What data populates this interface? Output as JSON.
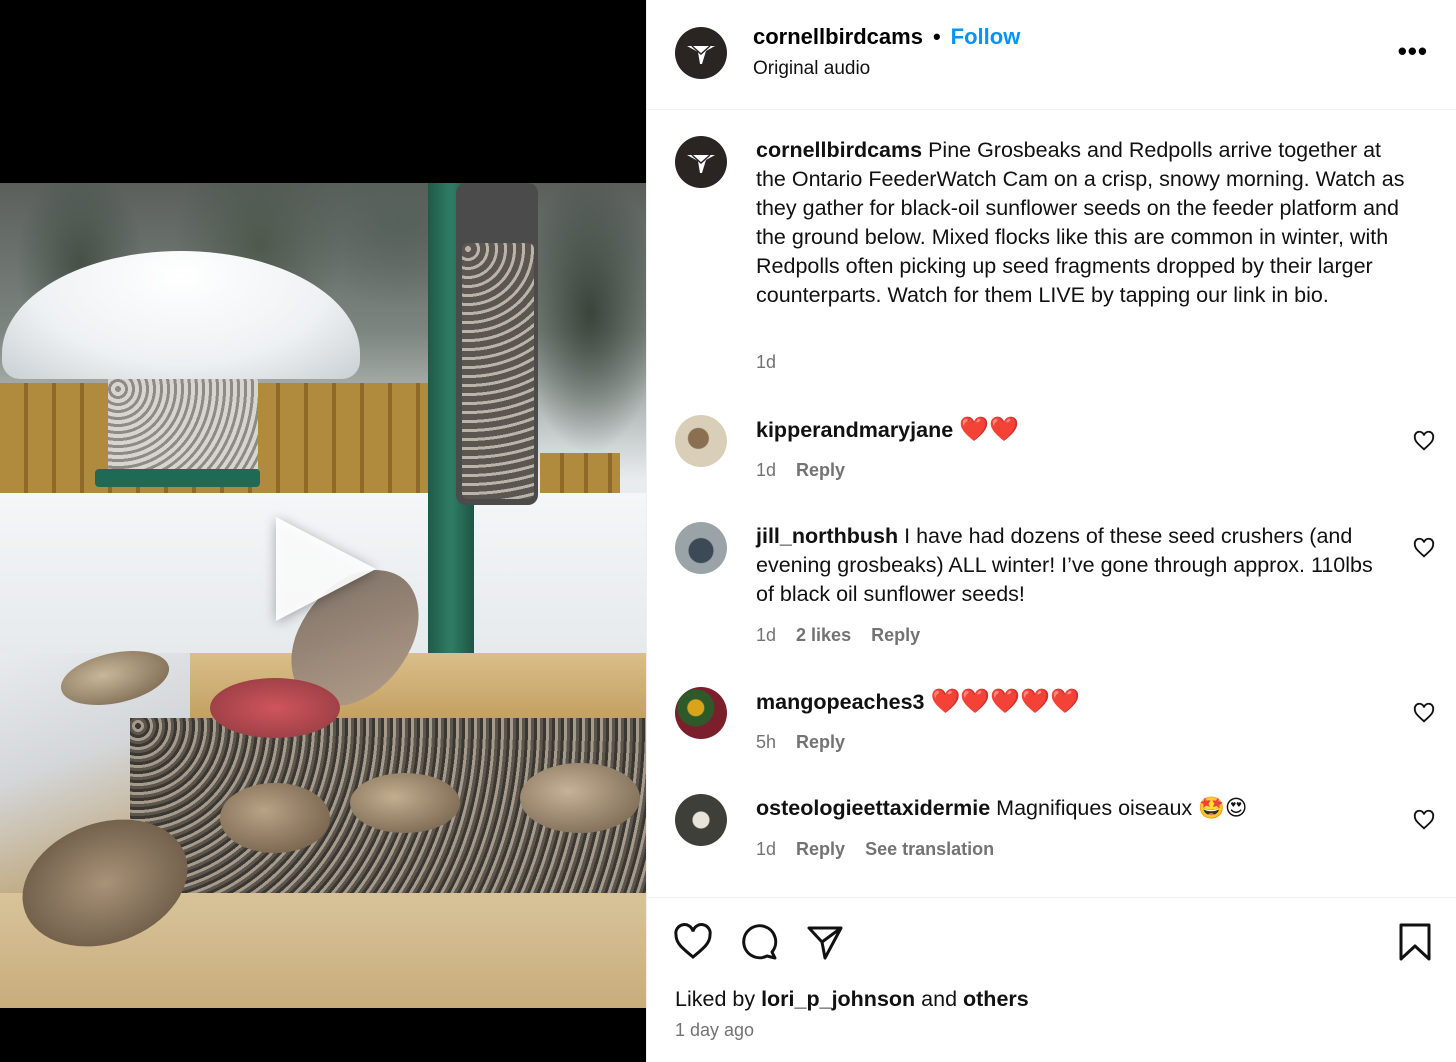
{
  "post": {
    "username": "cornellbirdcams",
    "follow_label": "Follow",
    "separator": "•",
    "audio": "Original audio",
    "more_label": "•••"
  },
  "caption": {
    "username": "cornellbirdcams",
    "text": "Pine Grosbeaks and Redpolls arrive together at the Ontario FeederWatch Cam on a crisp, snowy morning. Watch as they gather for black-oil sunflower seeds on the feeder platform and the ground below. Mixed flocks like this are common in winter, with Redpolls often picking up seed fragments dropped by their larger counterparts. Watch for them LIVE by tapping our link in bio.",
    "time": "1d"
  },
  "comments": [
    {
      "username": "kipperandmaryjane",
      "text": "",
      "emoji": "❤️❤️",
      "time": "1d",
      "likes": "",
      "reply": "Reply",
      "extra": ""
    },
    {
      "username": "jill_northbush",
      "text": "I have had dozens of these seed crushers (and evening grosbeaks) ALL winter! I’ve gone through approx. 110lbs of black oil sunflower seeds!",
      "emoji": "",
      "time": "1d",
      "likes": "2 likes",
      "reply": "Reply",
      "extra": ""
    },
    {
      "username": "mangopeaches3",
      "text": "",
      "emoji": "❤️❤️❤️❤️❤️",
      "time": "5h",
      "likes": "",
      "reply": "Reply",
      "extra": ""
    },
    {
      "username": "osteologieettaxidermie",
      "text": "Magnifiques oiseaux",
      "emoji": "🤩😍",
      "time": "1d",
      "likes": "",
      "reply": "Reply",
      "extra": "See translation"
    }
  ],
  "footer": {
    "liked_prefix": "Liked by",
    "liked_user": "lori_p_johnson",
    "liked_and": "and",
    "liked_others": "others",
    "time_ago": "1 day ago"
  },
  "icons": {
    "like": "heart-icon",
    "comment": "comment-icon",
    "share": "send-icon",
    "save": "bookmark-icon",
    "play": "play-icon"
  },
  "colors": {
    "accent": "#0095f6",
    "muted": "#737373"
  }
}
